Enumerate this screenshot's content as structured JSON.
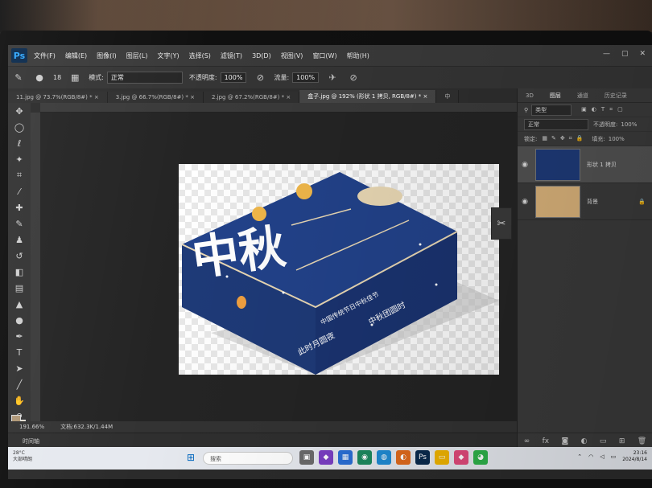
{
  "app": {
    "logo": "Ps"
  },
  "menu": [
    "文件(F)",
    "编辑(E)",
    "图像(I)",
    "图层(L)",
    "文字(Y)",
    "选择(S)",
    "滤镜(T)",
    "3D(D)",
    "视图(V)",
    "窗口(W)",
    "帮助(H)"
  ],
  "window_controls": [
    "—",
    "▢",
    "✕"
  ],
  "options": {
    "brush_size": "18",
    "mode_label": "模式:",
    "mode_value": "正常",
    "opacity_label": "不透明度:",
    "opacity_value": "100%",
    "flow_label": "流量:",
    "flow_value": "100%"
  },
  "tabs": [
    {
      "label": "11.jpg @ 73.7%(RGB/8#) *  ×"
    },
    {
      "label": "3.jpg @ 66.7%(RGB/8#) *  ×"
    },
    {
      "label": "2.jpg @ 67.2%(RGB/8#) *  ×"
    },
    {
      "label": "盒子.jpg @ 192% (形状 1 拷贝, RGB/8#) *  ×"
    },
    {
      "label": "中"
    }
  ],
  "status": {
    "zoom": "191.66%",
    "doc": "文档:632.3K/1.44M"
  },
  "timeline_label": "时间轴",
  "panel": {
    "tabs": [
      "3D",
      "图层",
      "通道",
      "历史记录"
    ],
    "filter_label": "类型",
    "blend_mode": "正常",
    "opacity_label": "不透明度:",
    "opacity_value": "100%",
    "lock_label": "锁定:",
    "fill_label": "填充:",
    "fill_value": "100%",
    "layers": [
      {
        "name": "形状 1 拷贝",
        "selected": true
      },
      {
        "name": "背景",
        "selected": false
      }
    ]
  },
  "artwork": {
    "title": "中秋",
    "line1": "中国传统节日中秋佳节",
    "line2": "此时月圆夜",
    "line3": "中秋团圆时"
  },
  "taskbar": {
    "weather_temp": "28°C",
    "weather_text": "大部晴朗",
    "search_placeholder": "搜索",
    "time": "23:16",
    "date": "2024/8/14"
  },
  "colors": {
    "box_blue": "#1e3a78",
    "box_side": "#1a3370",
    "foreground": "#b19877",
    "background": "#e8dcc6"
  }
}
